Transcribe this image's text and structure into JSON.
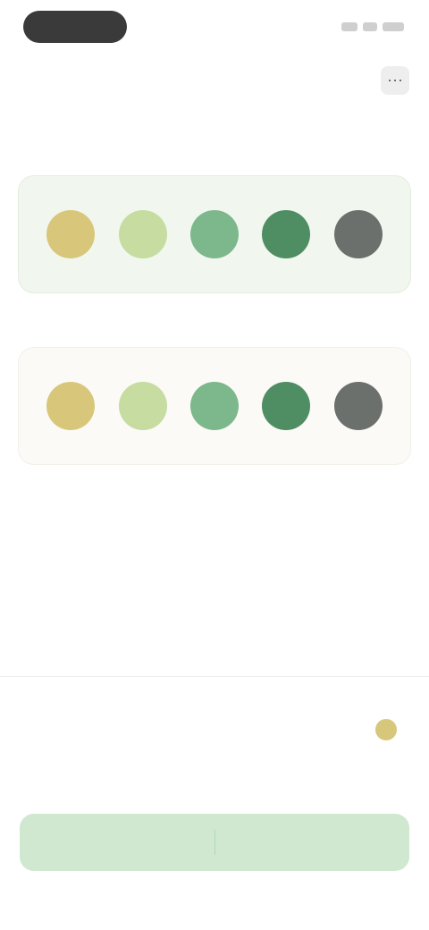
{
  "header": {
    "title": "",
    "corner_icon": "more-icon",
    "corner_glyph": "⋯"
  },
  "subheader": {
    "left": "",
    "right": ""
  },
  "palettes": [
    {
      "label": "",
      "selected": true,
      "swatches": [
        "#d8c77a",
        "#c6dca1",
        "#7cb88b",
        "#4f8d63",
        "#6c706d"
      ]
    },
    {
      "label": "",
      "selected": false,
      "swatches": [
        "#d8c77a",
        "#c6dca1",
        "#7cb88b",
        "#4f8d63",
        "#6c706d"
      ]
    }
  ],
  "summary": {
    "selected_label": "",
    "selected_value": "",
    "second_label": "",
    "second_value": ""
  },
  "cta": {
    "label": ""
  },
  "colors": {
    "accent": "#8bbd86",
    "cta_bg": "#cfe8cf",
    "selected_card_bg": "#f1f7ef"
  }
}
